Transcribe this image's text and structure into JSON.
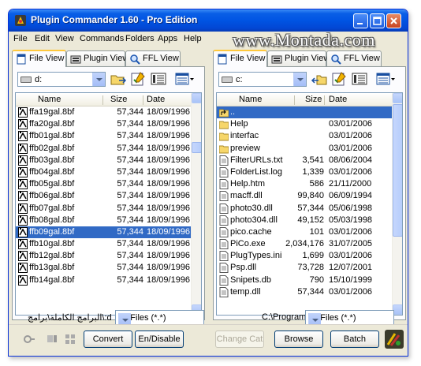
{
  "window": {
    "title": "Plugin Commander 1.60 - Pro Edition"
  },
  "watermark": "www.Montada.com",
  "menu": [
    "File",
    "Edit",
    "View",
    "Commands",
    "Folders",
    "Apps",
    "Help"
  ],
  "tabs": [
    "File View",
    "Plugin View",
    "FFL View"
  ],
  "columns": {
    "name": "Name",
    "size": "Size",
    "date": "Date"
  },
  "left": {
    "drive": "d:",
    "path": "البرامج الكاملة\\برامج\\:d",
    "filter": "All Files (*.*)",
    "files": [
      {
        "name": "ffa19gal.8bf",
        "size": "57,344",
        "date": "18/09/1996",
        "selected": false
      },
      {
        "name": "ffa20gal.8bf",
        "size": "57,344",
        "date": "18/09/1996",
        "selected": false
      },
      {
        "name": "ffb01gal.8bf",
        "size": "57,344",
        "date": "18/09/1996",
        "selected": false
      },
      {
        "name": "ffb02gal.8bf",
        "size": "57,344",
        "date": "18/09/1996",
        "selected": false
      },
      {
        "name": "ffb03gal.8bf",
        "size": "57,344",
        "date": "18/09/1996",
        "selected": false
      },
      {
        "name": "ffb04gal.8bf",
        "size": "57,344",
        "date": "18/09/1996",
        "selected": false
      },
      {
        "name": "ffb05gal.8bf",
        "size": "57,344",
        "date": "18/09/1996",
        "selected": false
      },
      {
        "name": "ffb06gal.8bf",
        "size": "57,344",
        "date": "18/09/1996",
        "selected": false
      },
      {
        "name": "ffb07gal.8bf",
        "size": "57,344",
        "date": "18/09/1996",
        "selected": false
      },
      {
        "name": "ffb08gal.8bf",
        "size": "57,344",
        "date": "18/09/1996",
        "selected": false
      },
      {
        "name": "ffb09gal.8bf",
        "size": "57,344",
        "date": "18/09/1996",
        "selected": true
      },
      {
        "name": "ffb10gal.8bf",
        "size": "57,344",
        "date": "18/09/1996",
        "selected": false
      },
      {
        "name": "ffb12gal.8bf",
        "size": "57,344",
        "date": "18/09/1996",
        "selected": false
      },
      {
        "name": "ffb13gal.8bf",
        "size": "57,344",
        "date": "18/09/1996",
        "selected": false
      },
      {
        "name": "ffb14gal.8bf",
        "size": "57,344",
        "date": "18/09/1996",
        "selected": false
      }
    ]
  },
  "right": {
    "drive": "c:",
    "path": "C:\\Program",
    "filter": "All Files (*.*)",
    "files": [
      {
        "name": "..",
        "size": "",
        "date": "",
        "kind": "up",
        "selected": true
      },
      {
        "name": "Help",
        "size": "",
        "date": "03/01/2006",
        "kind": "folder",
        "selected": false
      },
      {
        "name": "interfac",
        "size": "",
        "date": "03/01/2006",
        "kind": "folder",
        "selected": false
      },
      {
        "name": "preview",
        "size": "",
        "date": "03/01/2006",
        "kind": "folder",
        "selected": false
      },
      {
        "name": "FilterURLs.txt",
        "size": "3,541",
        "date": "08/06/2004",
        "kind": "file",
        "selected": false
      },
      {
        "name": "FolderList.log",
        "size": "1,339",
        "date": "03/01/2006",
        "kind": "file",
        "selected": false
      },
      {
        "name": "Help.htm",
        "size": "586",
        "date": "21/11/2000",
        "kind": "file",
        "selected": false
      },
      {
        "name": "macff.dll",
        "size": "99,840",
        "date": "06/09/1994",
        "kind": "file",
        "selected": false
      },
      {
        "name": "photo30.dll",
        "size": "57,344",
        "date": "05/06/1998",
        "kind": "file",
        "selected": false
      },
      {
        "name": "photo304.dll",
        "size": "49,152",
        "date": "05/03/1998",
        "kind": "file",
        "selected": false
      },
      {
        "name": "pico.cache",
        "size": "101",
        "date": "03/01/2006",
        "kind": "file",
        "selected": false
      },
      {
        "name": "PiCo.exe",
        "size": "2,034,176",
        "date": "31/07/2005",
        "kind": "file",
        "selected": false
      },
      {
        "name": "PlugTypes.ini",
        "size": "1,699",
        "date": "03/01/2006",
        "kind": "file",
        "selected": false
      },
      {
        "name": "Psp.dll",
        "size": "73,728",
        "date": "12/07/2001",
        "kind": "file",
        "selected": false
      },
      {
        "name": "Snipets.db",
        "size": "790",
        "date": "15/10/1999",
        "kind": "file",
        "selected": false
      },
      {
        "name": "temp.dll",
        "size": "57,344",
        "date": "03/01/2006",
        "kind": "file",
        "selected": false
      }
    ]
  },
  "buttons": {
    "convert": "Convert",
    "en_disable": "En/Disable",
    "change_cat": "Change Cat",
    "browse": "Browse",
    "batch": "Batch"
  }
}
